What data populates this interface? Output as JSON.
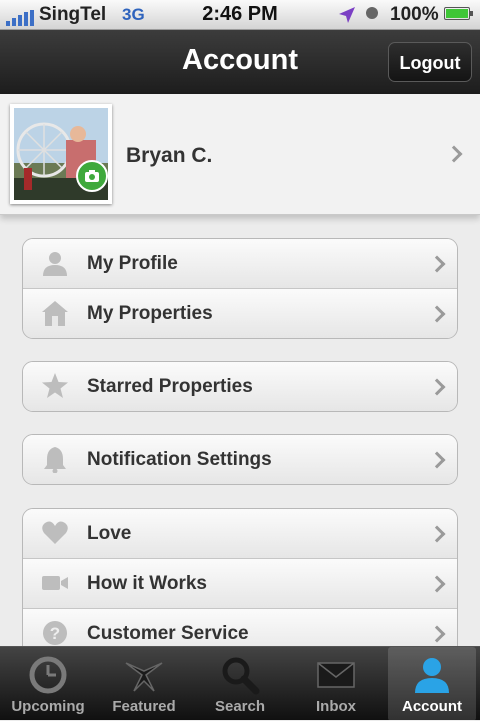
{
  "status_bar": {
    "carrier": "SingTel",
    "network": "3G",
    "time": "2:46 PM",
    "battery": "100%",
    "icons": [
      "signal-icon",
      "location-icon",
      "alarm-icon",
      "battery-icon"
    ]
  },
  "nav": {
    "title": "Account",
    "logout_label": "Logout"
  },
  "user": {
    "name": "Bryan C."
  },
  "menu": {
    "group1": [
      {
        "label": "My Profile",
        "icon": "person-icon"
      },
      {
        "label": "My Properties",
        "icon": "house-icon"
      }
    ],
    "group2": [
      {
        "label": "Starred Properties",
        "icon": "star-icon"
      }
    ],
    "group3": [
      {
        "label": "Notification Settings",
        "icon": "bell-icon"
      }
    ],
    "group4": [
      {
        "label": "Love",
        "icon": "heart-icon"
      },
      {
        "label": "How it Works",
        "icon": "video-icon"
      },
      {
        "label": "Customer Service",
        "icon": "question-icon"
      }
    ]
  },
  "tabs": [
    {
      "label": "Upcoming",
      "icon": "clock-icon"
    },
    {
      "label": "Featured",
      "icon": "featured-icon"
    },
    {
      "label": "Search",
      "icon": "search-icon"
    },
    {
      "label": "Inbox",
      "icon": "envelope-icon"
    },
    {
      "label": "Account",
      "icon": "person-icon",
      "active": true
    }
  ],
  "colors": {
    "accent_blue": "#2aa3e6",
    "camera_green": "#3fa93c",
    "nav_dark": "#1d1d1d"
  }
}
